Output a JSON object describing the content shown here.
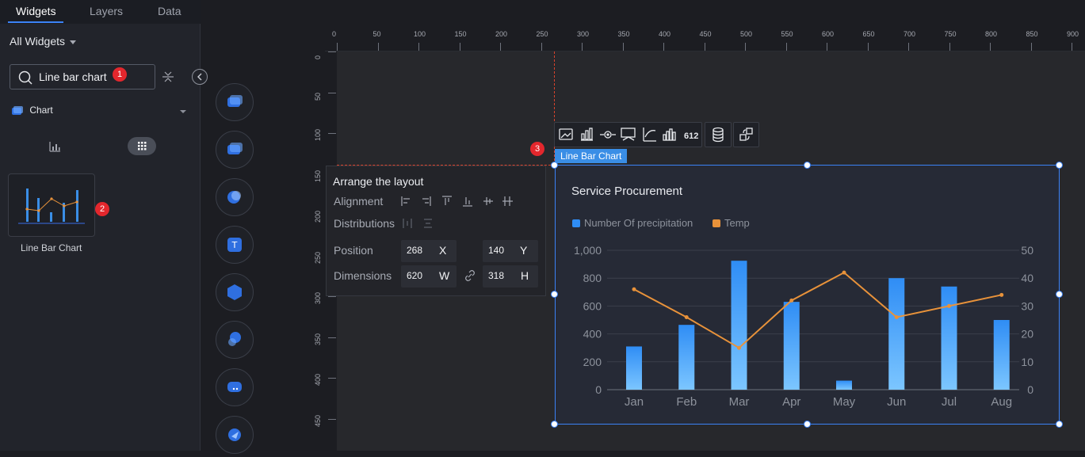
{
  "left_panel": {
    "tabs": [
      {
        "label": "Widgets",
        "active": true
      },
      {
        "label": "Layers",
        "active": false
      },
      {
        "label": "Data",
        "active": false
      }
    ],
    "dropdown_label": "All Widgets",
    "search": {
      "value": "Line bar chart"
    },
    "category_label": "Chart",
    "widget_label": "Line Bar Chart",
    "badges": [
      "1",
      "2",
      "3"
    ]
  },
  "ruler": {
    "x_ticks": [
      "0",
      "50",
      "100",
      "150",
      "200",
      "250",
      "300",
      "350",
      "400",
      "450",
      "500",
      "550",
      "600",
      "650",
      "700",
      "750",
      "800",
      "850",
      "900"
    ],
    "y_ticks": [
      "0",
      "50",
      "100",
      "150",
      "200",
      "250",
      "300",
      "350",
      "400",
      "450"
    ]
  },
  "selection_tag": "Line Bar Chart",
  "toolbar": {
    "badge_value": "612"
  },
  "layout_panel": {
    "title": "Arrange the layout",
    "alignment_label": "Alignment",
    "distributions_label": "Distributions",
    "position_label": "Position",
    "dimensions_label": "Dimensions",
    "x_value": "268",
    "x_unit": "X",
    "y_value": "140",
    "y_unit": "Y",
    "w_value": "620",
    "w_unit": "W",
    "h_value": "318",
    "h_unit": "H"
  },
  "colors": {
    "bar_top": "#2f8df5",
    "bar_bottom": "#7cc6ff",
    "line": "#e8923a",
    "accent": "#3b82f6",
    "badge": "#e3272d"
  },
  "chart_data": {
    "type": "bar",
    "title": "Service Procurement",
    "categories": [
      "Jan",
      "Feb",
      "Mar",
      "Apr",
      "May",
      "Jun",
      "Jul",
      "Aug"
    ],
    "series": [
      {
        "name": "Number Of precipitation",
        "type": "bar",
        "axis": "left",
        "values": [
          310,
          465,
          925,
          630,
          65,
          800,
          740,
          500
        ]
      },
      {
        "name": "Temp",
        "type": "line",
        "axis": "right",
        "values": [
          36,
          26,
          15,
          32,
          42,
          26,
          30,
          34
        ]
      }
    ],
    "y_left": {
      "ticks": [
        "0",
        "200",
        "400",
        "600",
        "800",
        "1,000"
      ],
      "range": [
        0,
        1000
      ]
    },
    "y_right": {
      "ticks": [
        "0",
        "10",
        "20",
        "30",
        "40",
        "50"
      ],
      "range": [
        0,
        50
      ]
    },
    "legend_position": "top-left",
    "grid": true
  }
}
